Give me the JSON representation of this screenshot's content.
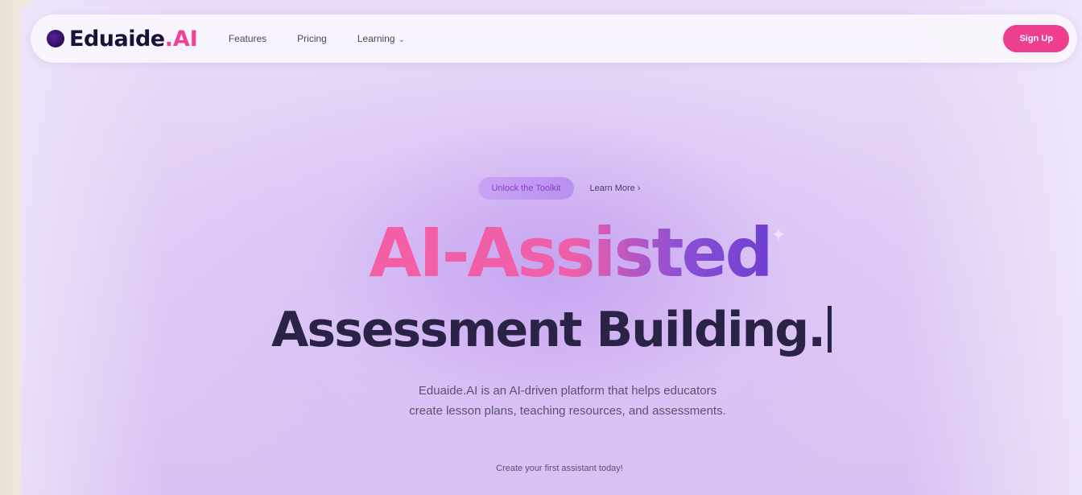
{
  "brand": {
    "name": "Eduaide",
    "accent": ".AI",
    "accent_color": "#f0409a"
  },
  "nav": {
    "links": [
      {
        "label": "Features"
      },
      {
        "label": "Pricing"
      },
      {
        "label": "Learning"
      }
    ],
    "signup_label": "Sign Up",
    "signup_color": "#ee3f8f"
  },
  "hero": {
    "pill_label": "Unlock the Toolkit",
    "learn_more_label": "Learn More",
    "headline_gradient": "AI-Assisted",
    "headline_main": "Assessment Building.",
    "description_line1": "Eduaide.AI is an AI-driven platform that helps educators",
    "description_line2": "create lesson plans, teaching resources, and assessments.",
    "cta_note": "Create your first assistant today!"
  }
}
